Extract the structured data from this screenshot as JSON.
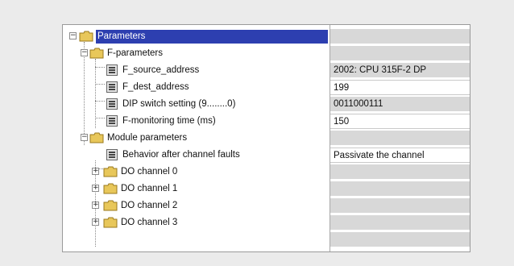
{
  "tree": {
    "root": {
      "label": "Parameters",
      "expander": "−",
      "value": ""
    },
    "fparams": {
      "label": "F-parameters",
      "expander": "−",
      "value": ""
    },
    "f_source": {
      "label": "F_source_address",
      "value": "2002: CPU 315F-2 DP"
    },
    "f_dest": {
      "label": "F_dest_address",
      "value": "199"
    },
    "dip": {
      "label": "DIP switch setting (9........0)",
      "value": "0011000111"
    },
    "fmon": {
      "label": "F-monitoring time (ms)",
      "value": "150"
    },
    "modparams": {
      "label": "Module parameters",
      "expander": "−",
      "value": ""
    },
    "behavior": {
      "label": "Behavior after channel faults",
      "value": "Passivate the channel"
    },
    "ch0": {
      "label": "DO channel 0",
      "expander": "+",
      "value": ""
    },
    "ch1": {
      "label": "DO channel 1",
      "expander": "+",
      "value": ""
    },
    "ch2": {
      "label": "DO channel 2",
      "expander": "+",
      "value": ""
    },
    "ch3": {
      "label": "DO channel 3",
      "expander": "+",
      "value": ""
    }
  },
  "icons": {
    "folder": "folder-icon",
    "parameter": "parameter-list-icon"
  },
  "colors": {
    "selection": "#2d3fb0",
    "folder": "#e8c75a",
    "value_grey": "#d8d8d8"
  }
}
